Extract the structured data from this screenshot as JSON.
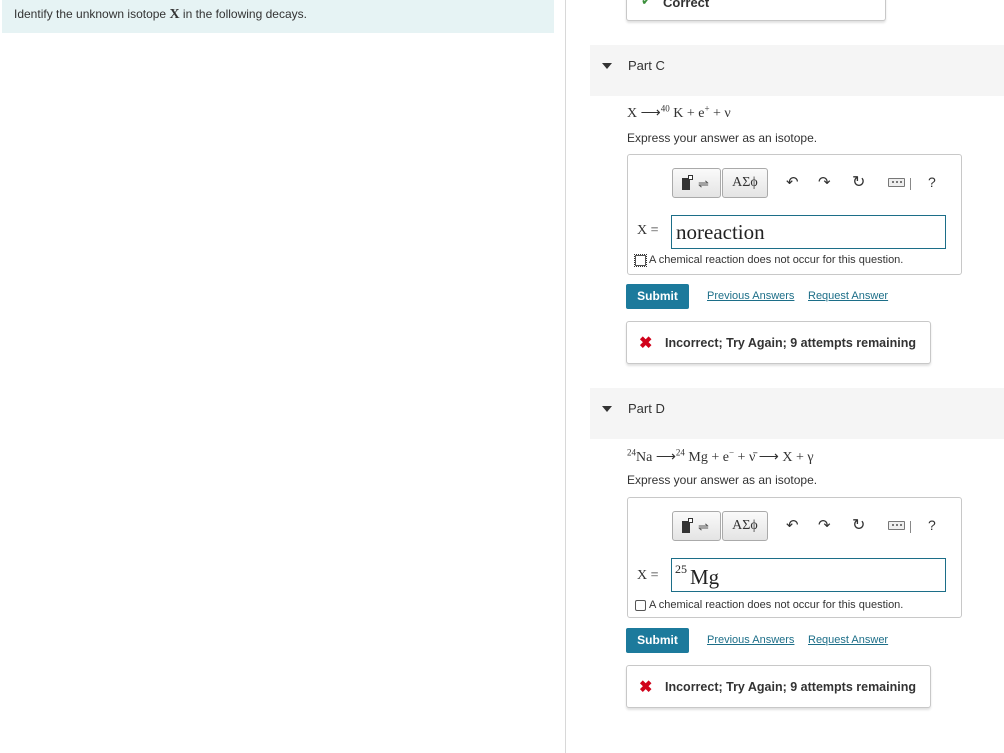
{
  "intro": {
    "text_before": "Identify the unknown isotope ",
    "variable": "X",
    "text_after": " in the following decays."
  },
  "previous_feedback": {
    "label": "Correct",
    "icon": "checkmark-icon"
  },
  "parts": [
    {
      "title": "Part C",
      "equation": {
        "lhs": "X",
        "arrow": "⟶",
        "mass": "40",
        "rest": "K + e",
        "charge": "+",
        "tail": " + ν"
      },
      "instruction": "Express your answer as an isotope.",
      "toolbar": {
        "greek_label": "ΑΣϕ",
        "help_label": "?"
      },
      "answer_label": "X =",
      "answer_value": "noreaction",
      "no_reaction_label": "A chemical reaction does not occur for this question.",
      "submit_label": "Submit",
      "previous_answers_label": "Previous Answers",
      "request_answer_label": "Request Answer",
      "feedback": "Incorrect; Try Again; 9 attempts remaining"
    },
    {
      "title": "Part D",
      "equation": {
        "mass1": "24",
        "sym1": "Na",
        "arrow1": "⟶",
        "mass2": "24",
        "sym2": "Mg + e",
        "charge": "−",
        "tail": " + ν̄ ⟶ X + γ"
      },
      "instruction": "Express your answer as an isotope.",
      "toolbar": {
        "greek_label": "ΑΣϕ",
        "help_label": "?"
      },
      "answer_label": "X =",
      "answer_mass": "25",
      "answer_symbol": "Mg",
      "no_reaction_label": "A chemical reaction does not occur for this question.",
      "submit_label": "Submit",
      "previous_answers_label": "Previous Answers",
      "request_answer_label": "Request Answer",
      "feedback": "Incorrect; Try Again; 9 attempts remaining"
    }
  ],
  "colors": {
    "banner_bg": "#e6f3f4",
    "submit_bg": "#1c7a9c",
    "link": "#1c6e88",
    "incorrect_icon": "#d0021b",
    "correct_icon": "#3c8f3c"
  }
}
